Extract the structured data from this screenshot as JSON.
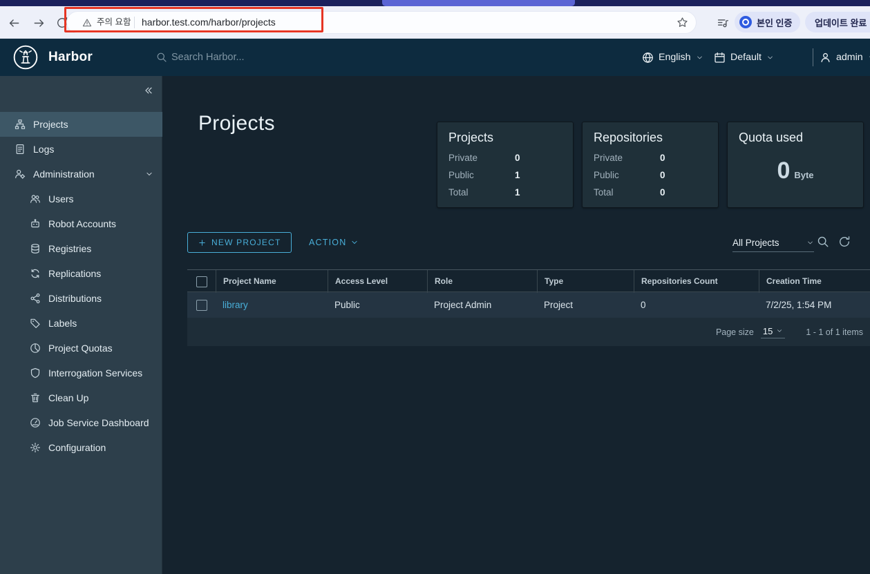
{
  "accent": "#49afd9",
  "browser": {
    "security_chip": "주의 요함",
    "url": "harbor.test.com/harbor/projects",
    "verify_label": "본인 인증",
    "update_label": "업데이트 완료"
  },
  "header": {
    "brand": "Harbor",
    "search_placeholder": "Search Harbor...",
    "language_label": "English",
    "theme_label": "Default",
    "user_label": "admin"
  },
  "sidebar": {
    "items": {
      "projects": "Projects",
      "logs": "Logs",
      "administration": "Administration"
    },
    "admin_children": [
      "Users",
      "Robot Accounts",
      "Registries",
      "Replications",
      "Distributions",
      "Labels",
      "Project Quotas",
      "Interrogation Services",
      "Clean Up",
      "Job Service Dashboard",
      "Configuration"
    ]
  },
  "main": {
    "title": "Projects",
    "cards": {
      "projects": {
        "title": "Projects",
        "rows": [
          {
            "label": "Private",
            "value": "0"
          },
          {
            "label": "Public",
            "value": "1"
          },
          {
            "label": "Total",
            "value": "1"
          }
        ]
      },
      "repositories": {
        "title": "Repositories",
        "rows": [
          {
            "label": "Private",
            "value": "0"
          },
          {
            "label": "Public",
            "value": "0"
          },
          {
            "label": "Total",
            "value": "0"
          }
        ]
      },
      "quota": {
        "title": "Quota used",
        "value": "0",
        "unit": "Byte"
      }
    },
    "actions": {
      "new_project": "NEW PROJECT",
      "action": "ACTION",
      "filter": "All Projects"
    },
    "table": {
      "columns": [
        "Project Name",
        "Access Level",
        "Role",
        "Type",
        "Repositories Count",
        "Creation Time"
      ],
      "row": {
        "name": "library",
        "access": "Public",
        "role": "Project Admin",
        "type": "Project",
        "repos": "0",
        "created": "7/2/25, 1:54 PM"
      },
      "footer": {
        "page_size_label": "Page size",
        "page_size": "15",
        "range": "1 - 1 of 1 items"
      }
    }
  }
}
